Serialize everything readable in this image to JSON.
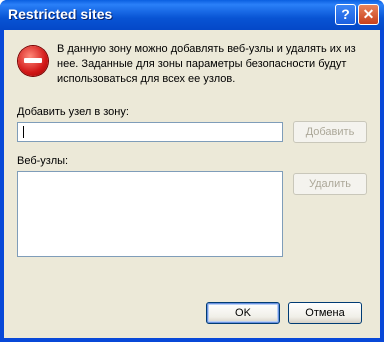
{
  "window": {
    "title": "Restricted sites"
  },
  "titlebar": {
    "help_glyph": "?",
    "close_glyph": "✕"
  },
  "info_text": "В данную зону можно добавлять веб-узлы и удалять их из нее. Заданные для зоны параметры безопасности будут использоваться для всех ее узлов.",
  "add_site": {
    "label": "Добавить узел  в зону:",
    "value": "",
    "add_button": "Добавить"
  },
  "sites": {
    "label": "Веб-узлы:",
    "items": [],
    "remove_button": "Удалить"
  },
  "footer": {
    "ok_button": "OK",
    "cancel_button": "Отмена"
  },
  "colors": {
    "titlebar": "#0854d4",
    "client": "#ece9d8",
    "stop_icon": "#d21818"
  },
  "icons": [
    "help-icon",
    "close-icon",
    "stop-icon"
  ]
}
